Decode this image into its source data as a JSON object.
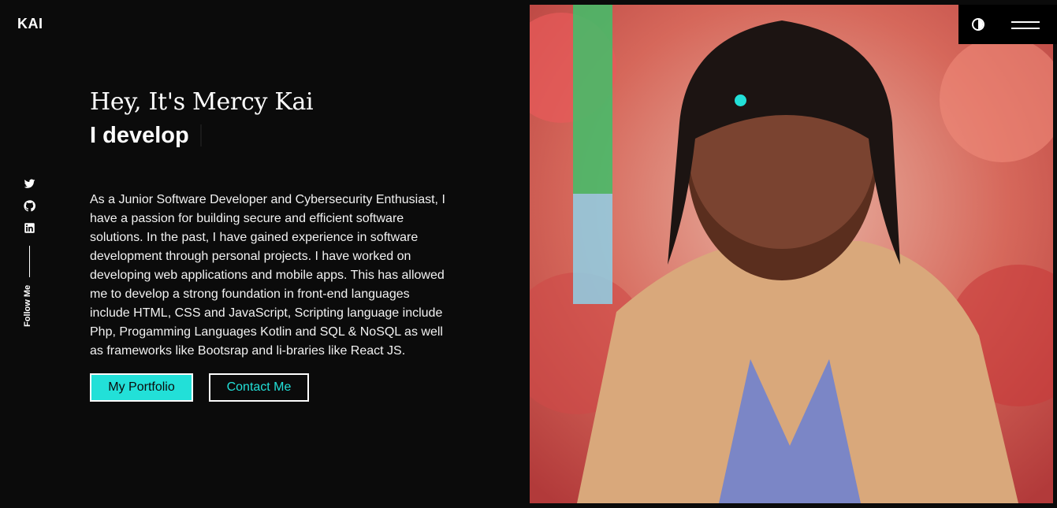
{
  "brand": {
    "logo": "KAI"
  },
  "social": {
    "icons": [
      "twitter-icon",
      "github-icon",
      "linkedin-icon"
    ],
    "follow_label": "Follow Me"
  },
  "hero": {
    "greeting": "Hey, It's Mercy Kai",
    "role_prefix": "I develop",
    "about": "As a Junior Software Developer and Cybersecurity Enthusiast, I have a passion for building secure and efficient software solutions. In the past, I have gained experience in software development through personal projects. I have worked on developing web applications and mobile apps. This has allowed me to develop a strong foundation in front-end languages include HTML, CSS and JavaScript, Scripting language include Php, Progamming Languages Kotlin and SQL & NoSQL as well as frameworks like Bootsrap and li-braries like React JS.",
    "buttons": {
      "portfolio": "My Portfolio",
      "contact": "Contact Me"
    }
  },
  "header": {
    "icons": [
      "theme-toggle-icon",
      "hamburger-menu-icon"
    ]
  },
  "colors": {
    "background": "#0b0b0b",
    "accent": "#22e0d8",
    "text": "#ffffff"
  }
}
